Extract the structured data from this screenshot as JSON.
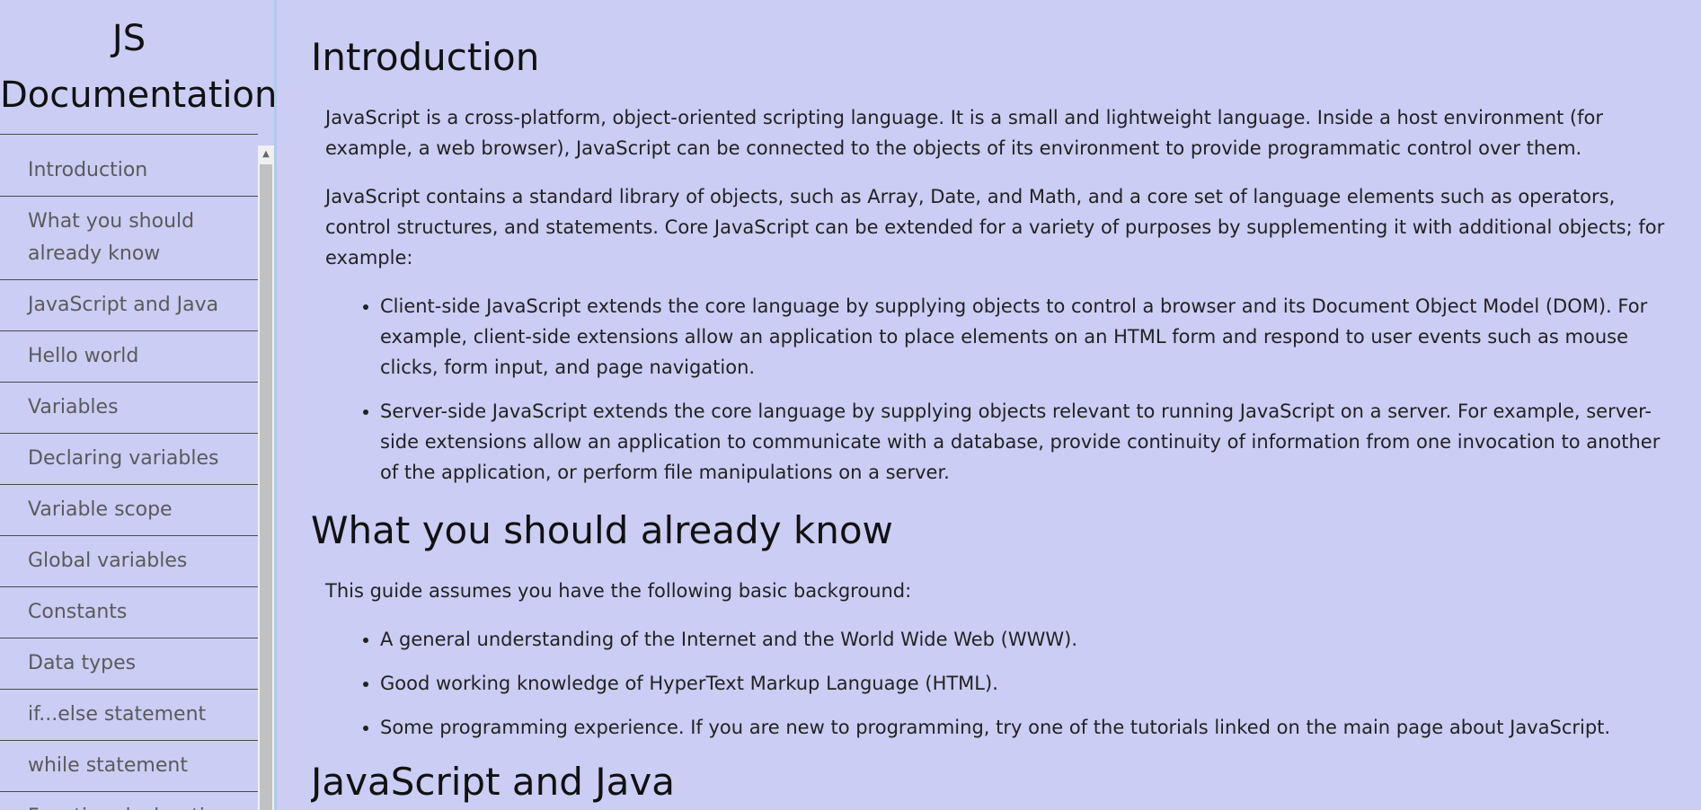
{
  "sidebar": {
    "title": "JS Documentation",
    "items": [
      {
        "label": "Introduction"
      },
      {
        "label": "What you should already know"
      },
      {
        "label": "JavaScript and Java"
      },
      {
        "label": "Hello world"
      },
      {
        "label": "Variables"
      },
      {
        "label": "Declaring variables"
      },
      {
        "label": "Variable scope"
      },
      {
        "label": "Global variables"
      },
      {
        "label": "Constants"
      },
      {
        "label": "Data types"
      },
      {
        "label": "if...else statement"
      },
      {
        "label": "while statement"
      },
      {
        "label": "Function declarations"
      }
    ]
  },
  "main": {
    "sections": [
      {
        "title": "Introduction",
        "paragraphs": [
          "JavaScript is a cross-platform, object-oriented scripting language. It is a small and lightweight language. Inside a host environment (for example, a web browser), JavaScript can be connected to the objects of its environment to provide programmatic control over them.",
          "JavaScript contains a standard library of objects, such as Array, Date, and Math, and a core set of language elements such as operators, control structures, and statements. Core JavaScript can be extended for a variety of purposes by supplementing it with additional objects; for example:"
        ],
        "list": [
          "Client-side JavaScript extends the core language by supplying objects to control a browser and its Document Object Model (DOM). For example, client-side extensions allow an application to place elements on an HTML form and respond to user events such as mouse clicks, form input, and page navigation.",
          "Server-side JavaScript extends the core language by supplying objects relevant to running JavaScript on a server. For example, server-side extensions allow an application to communicate with a database, provide continuity of information from one invocation to another of the application, or perform file manipulations on a server."
        ]
      },
      {
        "title": "What you should already know",
        "paragraphs": [
          "This guide assumes you have the following basic background:"
        ],
        "list": [
          "A general understanding of the Internet and the World Wide Web (WWW).",
          "Good working knowledge of HyperText Markup Language (HTML).",
          "Some programming experience. If you are new to programming, try one of the tutorials linked on the main page about JavaScript."
        ]
      },
      {
        "title": "JavaScript and Java"
      }
    ]
  },
  "colors": {
    "background": "#cbcdf5",
    "sidebar_border": "#a9cdf0",
    "nav_text": "#5a5a5a",
    "scroll_thumb": "#c1c1c1"
  }
}
